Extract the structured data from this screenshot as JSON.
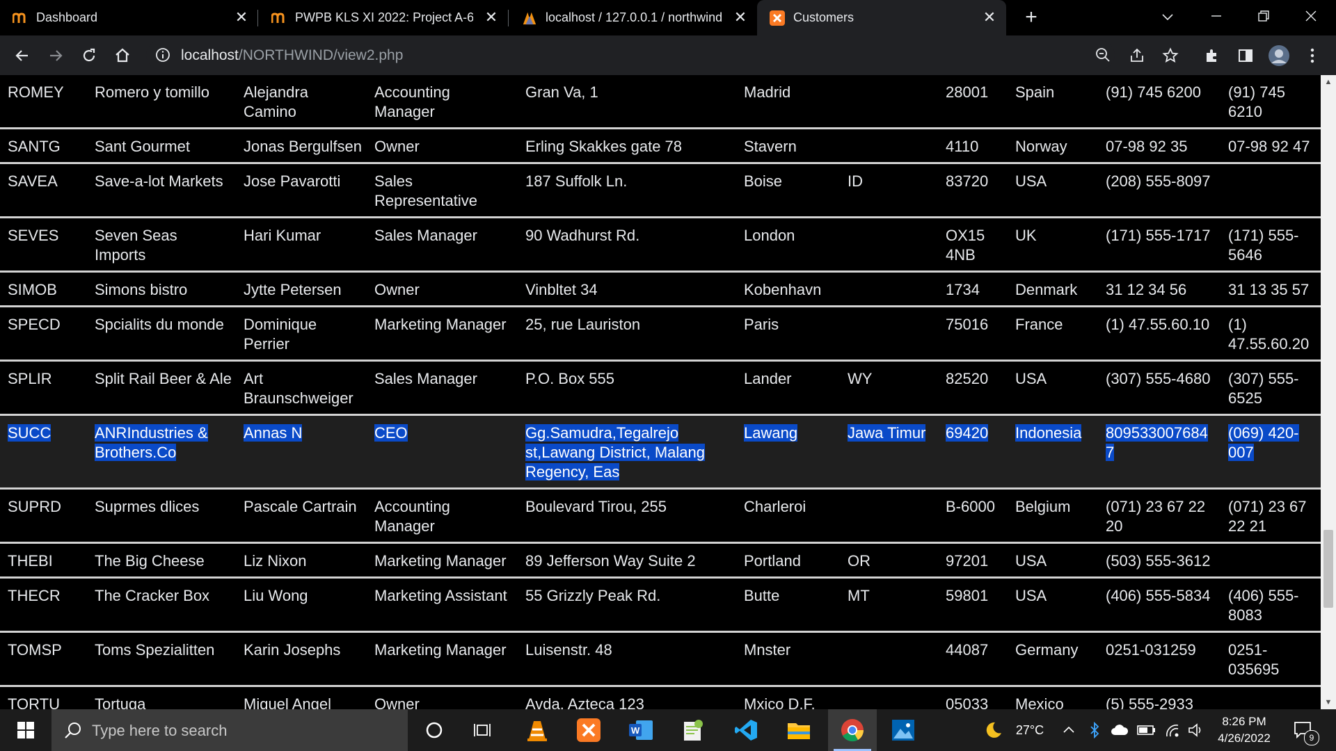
{
  "browser": {
    "tabs": [
      {
        "title": "Dashboard",
        "icon": "moodle-icon",
        "active": false
      },
      {
        "title": "PWPB KLS XI 2022: Project A-6 -",
        "icon": "moodle-icon",
        "active": false
      },
      {
        "title": "localhost / 127.0.0.1 / northwind",
        "icon": "phpmyadmin-icon",
        "active": false
      },
      {
        "title": "Customers",
        "icon": "xampp-icon",
        "active": true
      }
    ],
    "url": {
      "host": "localhost",
      "path": "/NORTHWIND/view2.php"
    }
  },
  "table": {
    "rows": [
      [
        "ROMEY",
        "Romero y tomillo",
        "Alejandra Camino",
        "Accounting Manager",
        "Gran Va, 1",
        "Madrid",
        "",
        "28001",
        "Spain",
        "(91) 745 6200",
        "(91) 745 6210"
      ],
      [
        "SANTG",
        "Sant Gourmet",
        "Jonas Bergulfsen",
        "Owner",
        "Erling Skakkes gate 78",
        "Stavern",
        "",
        "4110",
        "Norway",
        "07-98 92 35",
        "07-98 92 47"
      ],
      [
        "SAVEA",
        "Save-a-lot Markets",
        "Jose Pavarotti",
        "Sales Representative",
        "187 Suffolk Ln.",
        "Boise",
        "ID",
        "83720",
        "USA",
        "(208) 555-8097",
        ""
      ],
      [
        "SEVES",
        "Seven Seas Imports",
        "Hari Kumar",
        "Sales Manager",
        "90 Wadhurst Rd.",
        "London",
        "",
        "OX15 4NB",
        "UK",
        "(171) 555-1717",
        "(171) 555-5646"
      ],
      [
        "SIMOB",
        "Simons bistro",
        "Jytte Petersen",
        "Owner",
        "Vinbltet 34",
        "Kobenhavn",
        "",
        "1734",
        "Denmark",
        "31 12 34 56",
        "31 13 35 57"
      ],
      [
        "SPECD",
        "Spcialits du monde",
        "Dominique Perrier",
        "Marketing Manager",
        "25, rue Lauriston",
        "Paris",
        "",
        "75016",
        "France",
        "(1) 47.55.60.10",
        "(1) 47.55.60.20"
      ],
      [
        "SPLIR",
        "Split Rail Beer & Ale",
        "Art Braunschweiger",
        "Sales Manager",
        "P.O. Box 555",
        "Lander",
        "WY",
        "82520",
        "USA",
        "(307) 555-4680",
        "(307) 555-6525"
      ],
      [
        "SUCC",
        "ANRIndustries & Brothers.Co",
        "Annas N",
        "CEO",
        "Gg.Samudra,Tegalrejo st,Lawang District, Malang Regency, Eas",
        "Lawang",
        "Jawa Timur",
        "69420",
        "Indonesia",
        "8095330076847",
        "(069) 420-007"
      ],
      [
        "SUPRD",
        "Suprmes dlices",
        "Pascale Cartrain",
        "Accounting Manager",
        "Boulevard Tirou, 255",
        "Charleroi",
        "",
        "B-6000",
        "Belgium",
        "(071) 23 67 22 20",
        "(071) 23 67 22 21"
      ],
      [
        "THEBI",
        "The Big Cheese",
        "Liz Nixon",
        "Marketing Manager",
        "89 Jefferson Way Suite 2",
        "Portland",
        "OR",
        "97201",
        "USA",
        "(503) 555-3612",
        ""
      ],
      [
        "THECR",
        "The Cracker Box",
        "Liu Wong",
        "Marketing Assistant",
        "55 Grizzly Peak Rd.",
        "Butte",
        "MT",
        "59801",
        "USA",
        "(406) 555-5834",
        "(406) 555-8083"
      ],
      [
        "TOMSP",
        "Toms Spezialitten",
        "Karin Josephs",
        "Marketing Manager",
        "Luisenstr. 48",
        "Mnster",
        "",
        "44087",
        "Germany",
        "0251-031259",
        "0251-035695"
      ],
      [
        "TORTU",
        "Tortuga Restaurante",
        "Miguel Angel Paolino",
        "Owner",
        "Avda. Azteca 123",
        "Mxico D.F.",
        "",
        "05033",
        "Mexico",
        "(5) 555-2933",
        ""
      ]
    ],
    "selected_row": 7
  },
  "taskbar": {
    "search_placeholder": "Type here to search",
    "weather": "27°C",
    "time": "8:26 PM",
    "date": "4/26/2022",
    "notifications": "9"
  },
  "colors": {
    "accent": "#0a4ac8",
    "page_bg": "#000000",
    "chrome_bg": "#202124"
  }
}
